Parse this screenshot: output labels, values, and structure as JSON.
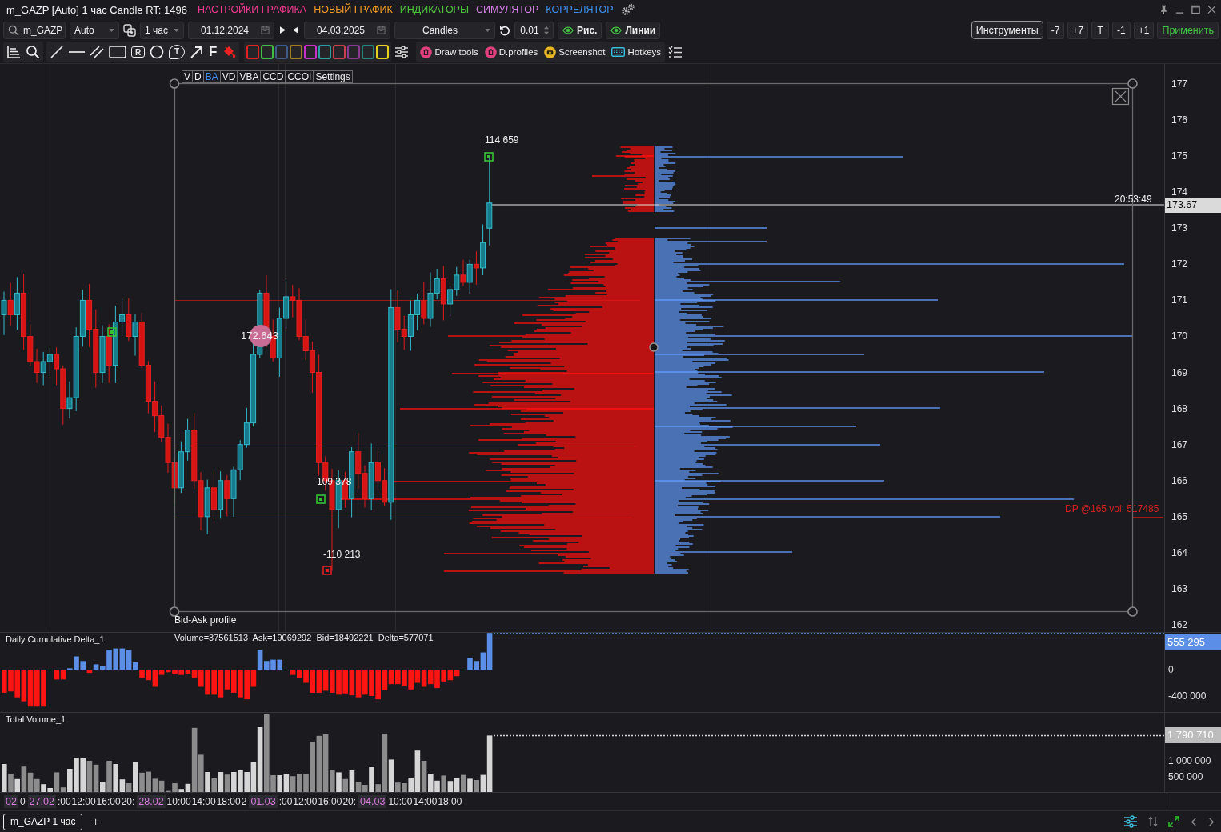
{
  "window": {
    "title": "m_GAZP [Auto] 1 час Candle RT: 1496",
    "menu": [
      {
        "label": "НАСТРОЙКИ ГРАФИКА",
        "color": "#f0398f"
      },
      {
        "label": "НОВЫЙ ГРАФИК",
        "color": "#f39a26"
      },
      {
        "label": "ИНДИКАТОРЫ",
        "color": "#4ec43c"
      },
      {
        "label": "СИМУЛЯТОР",
        "color": "#d77fe8"
      },
      {
        "label": "КОРРЕЛЯТОР",
        "color": "#3d8ff0"
      }
    ]
  },
  "toolbar": {
    "symbol": "m_GAZP",
    "mode": "Auto",
    "timeframe": "1 час",
    "date_from": "01.12.2024",
    "date_to": "04.03.2025",
    "chart_type": "Candles",
    "step": "0.01",
    "toggles": [
      {
        "label": "Рис.",
        "on": true
      },
      {
        "label": "Линии",
        "on": true
      }
    ],
    "tools_button": "Инструменты",
    "shift_buttons": [
      "-7",
      "+7",
      "T",
      "-1",
      "+1"
    ],
    "apply_button": "Применить"
  },
  "drawing_bar": {
    "label_tool": "R",
    "callout_tool": "T",
    "text_tool": "F",
    "swatches": [
      {
        "color": "#e52222"
      },
      {
        "color": "#3fbf45"
      },
      {
        "color": "#3e5b8a"
      },
      {
        "color": "#a08020"
      },
      {
        "color": "#c832c8"
      },
      {
        "color": "#2aa0a0"
      },
      {
        "color": "#c8404e"
      },
      {
        "color": "#8a3a90"
      },
      {
        "color": "#24857a"
      },
      {
        "color": "#e6d21e"
      }
    ],
    "buttons": [
      {
        "kind": "clear",
        "label": "Draw tools"
      },
      {
        "kind": "clear",
        "label": "D.profiles"
      },
      {
        "kind": "screenshot",
        "label": "Screenshot"
      },
      {
        "kind": "keyboard",
        "label": "Hotkeys"
      }
    ]
  },
  "chart": {
    "profile_tabs": [
      {
        "label": "V",
        "selected": false
      },
      {
        "label": "D",
        "selected": false
      },
      {
        "label": "BA",
        "selected": true
      },
      {
        "label": "VD",
        "selected": false
      },
      {
        "label": "VBA",
        "selected": false
      },
      {
        "label": "CCD",
        "selected": false
      },
      {
        "label": "CCOI",
        "selected": false
      }
    ],
    "profile_settings": "Settings",
    "profile_title": "Bid-Ask profile",
    "profile_stats": "Volume=37561513  Ask=19069292  Bid=18492221  Delta=577071",
    "cursor_price": "172.643",
    "markers": [
      {
        "kind": "positive",
        "label": "114 659"
      },
      {
        "kind": "positive",
        "label": "109 378"
      },
      {
        "kind": "negative",
        "label": "-110 213"
      },
      {
        "kind": "positive"
      }
    ],
    "last_time": "20:53:49",
    "last_price": "173.67",
    "dp_label": "DP @165 vol: 517485",
    "price_axis": [
      "177",
      "176",
      "175",
      "174",
      "173",
      "172",
      "171",
      "170",
      "169",
      "168",
      "167",
      "166",
      "165",
      "164",
      "163",
      "162"
    ]
  },
  "delta_panel": {
    "title": "Daily Cumulative Delta_1",
    "axis_labels": [
      "0",
      "-400 000"
    ],
    "last_value": "555 295"
  },
  "volume_panel": {
    "title": "Total Volume_1",
    "axis_labels": [
      "1 000 000",
      "500 000"
    ],
    "last_value": "1 790 710"
  },
  "time_axis": [
    {
      "kind": "date",
      "label": "02"
    },
    {
      "kind": "time",
      "label": "0"
    },
    {
      "kind": "date",
      "label": "27.02"
    },
    {
      "kind": "time",
      "label": ":00"
    },
    {
      "kind": "time",
      "label": "12:00"
    },
    {
      "kind": "time",
      "label": "16:00"
    },
    {
      "kind": "time",
      "label": "20:"
    },
    {
      "kind": "date",
      "label": "28.02"
    },
    {
      "kind": "time",
      "label": "10:00"
    },
    {
      "kind": "time",
      "label": "14:00"
    },
    {
      "kind": "time",
      "label": "18:00"
    },
    {
      "kind": "time",
      "label": "2"
    },
    {
      "kind": "date",
      "label": "01.03"
    },
    {
      "kind": "time",
      "label": ":00"
    },
    {
      "kind": "time",
      "label": "12:00"
    },
    {
      "kind": "time",
      "label": "16:00"
    },
    {
      "kind": "time",
      "label": "20:"
    },
    {
      "kind": "date",
      "label": "04.03"
    },
    {
      "kind": "time",
      "label": "10:00"
    },
    {
      "kind": "time",
      "label": "14:00"
    },
    {
      "kind": "time",
      "label": "18:00"
    }
  ],
  "tabs": [
    {
      "label": "m_GAZP 1 час",
      "selected": true
    }
  ],
  "add_tab": "+"
}
